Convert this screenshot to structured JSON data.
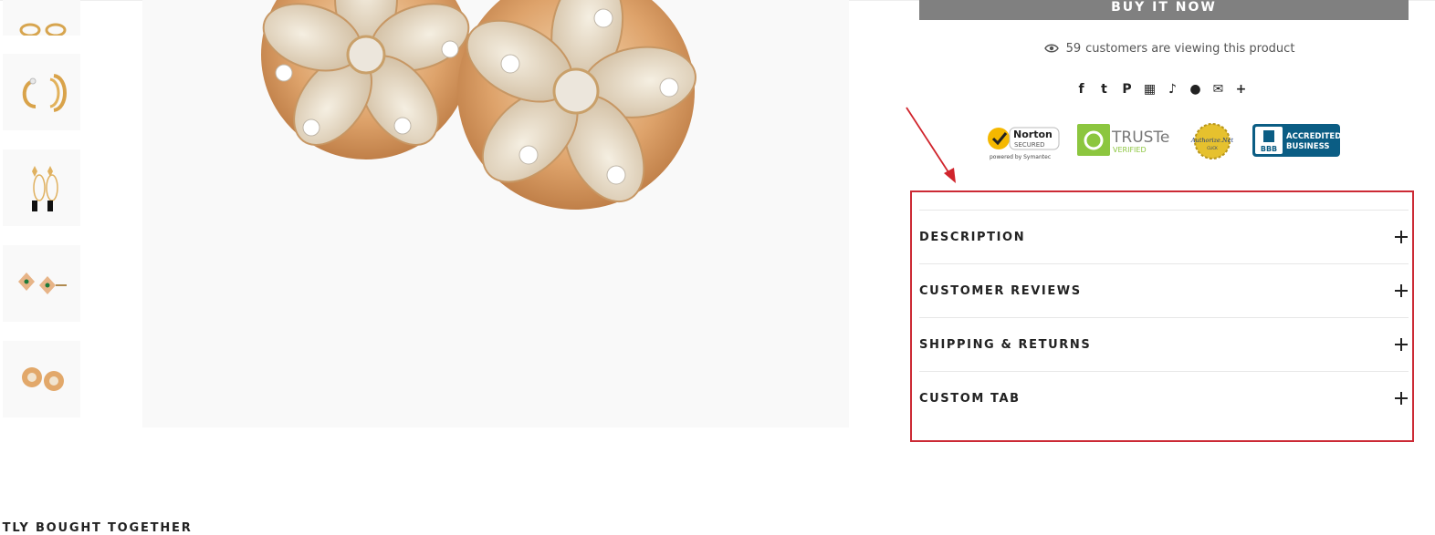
{
  "purchase": {
    "buy_now_label": "BUY IT NOW"
  },
  "viewing": {
    "count": "59",
    "text": "customers are viewing this product"
  },
  "share": {
    "icons": [
      {
        "name": "facebook-icon",
        "glyph": "f"
      },
      {
        "name": "twitter-icon",
        "glyph": "t"
      },
      {
        "name": "pinterest-icon",
        "glyph": "P"
      },
      {
        "name": "grid-icon",
        "glyph": "▦"
      },
      {
        "name": "tumblr-icon",
        "glyph": "♪"
      },
      {
        "name": "pocket-icon",
        "glyph": "●"
      },
      {
        "name": "email-icon",
        "glyph": "✉"
      },
      {
        "name": "more-icon",
        "glyph": "+"
      }
    ]
  },
  "trust_badges": {
    "norton": {
      "name": "Norton",
      "sub": "SECURED",
      "powered": "powered by Symantec"
    },
    "truste": {
      "name": "TRUSTe",
      "sub": "VERIFIED"
    },
    "authorize": {
      "name": "Authorize.Net",
      "sub": "CLICK"
    },
    "bbb": {
      "name": "BBB",
      "line1": "ACCREDITED",
      "line2": "BUSINESS"
    }
  },
  "accordion": {
    "items": [
      {
        "label": "DESCRIPTION"
      },
      {
        "label": "CUSTOMER REVIEWS"
      },
      {
        "label": "SHIPPING & RETURNS"
      },
      {
        "label": "CUSTOM TAB"
      }
    ]
  },
  "frequently_bought": {
    "title": "NTLY BOUGHT TOGETHER"
  },
  "colors": {
    "highlight": "#cc2a35",
    "button": "#808080",
    "gold": "#d9a15a",
    "bbb_blue": "#0b5d84"
  }
}
